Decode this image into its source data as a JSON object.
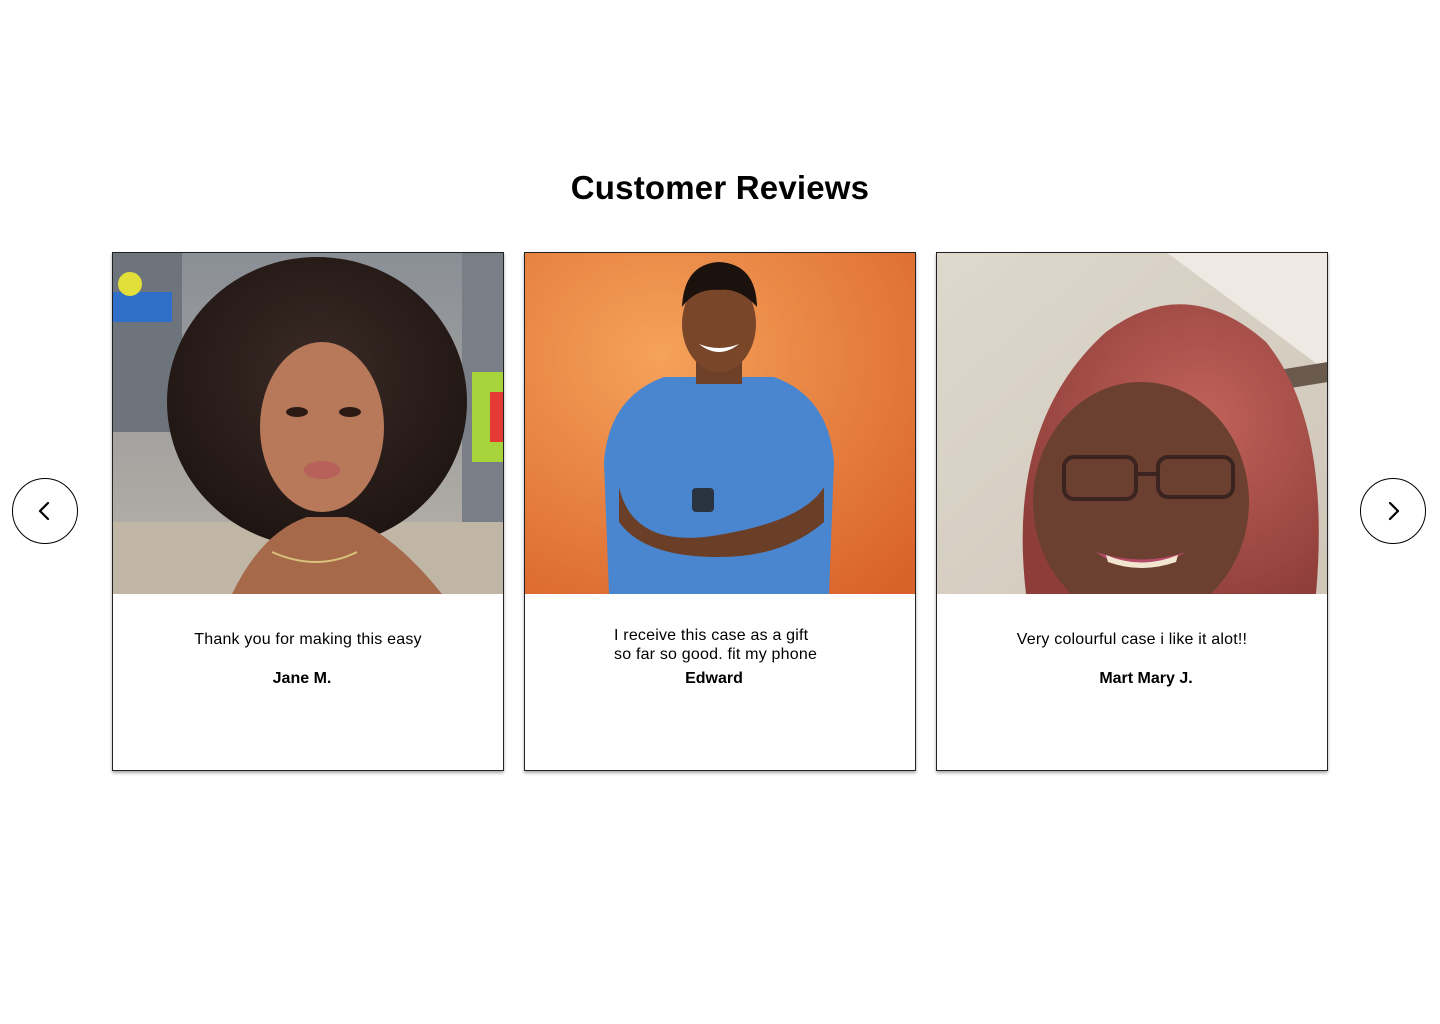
{
  "section": {
    "title": "Customer Reviews"
  },
  "carousel": {
    "prev_icon": "chevron-left-icon",
    "next_icon": "chevron-right-icon"
  },
  "reviews": [
    {
      "text": "Thank you for making this easy",
      "name": "Jane M.",
      "photo": "woman-curly-hair-portrait"
    },
    {
      "text": "I receive this case as a gift\nso far so good. fit my phone",
      "name": "Edward",
      "photo": "man-blue-tshirt-orange-background"
    },
    {
      "text": "Very colourful case i like it alot!!",
      "name": "Mart Mary J.",
      "photo": "older-woman-glasses-selfie"
    }
  ],
  "colors": {
    "background": "#ffffff",
    "text": "#000000",
    "photo2_bg": "#ef8a3e",
    "photo2_shirt": "#4a86cf"
  }
}
